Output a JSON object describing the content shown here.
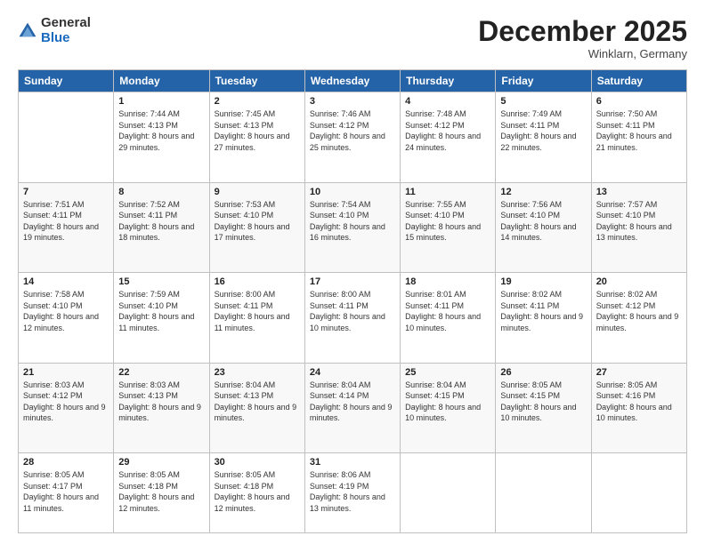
{
  "header": {
    "logo": {
      "general": "General",
      "blue": "Blue"
    },
    "title": "December 2025",
    "location": "Winklarn, Germany"
  },
  "columns": [
    "Sunday",
    "Monday",
    "Tuesday",
    "Wednesday",
    "Thursday",
    "Friday",
    "Saturday"
  ],
  "weeks": [
    [
      {
        "day": "",
        "sunrise": "",
        "sunset": "",
        "daylight": ""
      },
      {
        "day": "1",
        "sunrise": "Sunrise: 7:44 AM",
        "sunset": "Sunset: 4:13 PM",
        "daylight": "Daylight: 8 hours and 29 minutes."
      },
      {
        "day": "2",
        "sunrise": "Sunrise: 7:45 AM",
        "sunset": "Sunset: 4:13 PM",
        "daylight": "Daylight: 8 hours and 27 minutes."
      },
      {
        "day": "3",
        "sunrise": "Sunrise: 7:46 AM",
        "sunset": "Sunset: 4:12 PM",
        "daylight": "Daylight: 8 hours and 25 minutes."
      },
      {
        "day": "4",
        "sunrise": "Sunrise: 7:48 AM",
        "sunset": "Sunset: 4:12 PM",
        "daylight": "Daylight: 8 hours and 24 minutes."
      },
      {
        "day": "5",
        "sunrise": "Sunrise: 7:49 AM",
        "sunset": "Sunset: 4:11 PM",
        "daylight": "Daylight: 8 hours and 22 minutes."
      },
      {
        "day": "6",
        "sunrise": "Sunrise: 7:50 AM",
        "sunset": "Sunset: 4:11 PM",
        "daylight": "Daylight: 8 hours and 21 minutes."
      }
    ],
    [
      {
        "day": "7",
        "sunrise": "Sunrise: 7:51 AM",
        "sunset": "Sunset: 4:11 PM",
        "daylight": "Daylight: 8 hours and 19 minutes."
      },
      {
        "day": "8",
        "sunrise": "Sunrise: 7:52 AM",
        "sunset": "Sunset: 4:11 PM",
        "daylight": "Daylight: 8 hours and 18 minutes."
      },
      {
        "day": "9",
        "sunrise": "Sunrise: 7:53 AM",
        "sunset": "Sunset: 4:10 PM",
        "daylight": "Daylight: 8 hours and 17 minutes."
      },
      {
        "day": "10",
        "sunrise": "Sunrise: 7:54 AM",
        "sunset": "Sunset: 4:10 PM",
        "daylight": "Daylight: 8 hours and 16 minutes."
      },
      {
        "day": "11",
        "sunrise": "Sunrise: 7:55 AM",
        "sunset": "Sunset: 4:10 PM",
        "daylight": "Daylight: 8 hours and 15 minutes."
      },
      {
        "day": "12",
        "sunrise": "Sunrise: 7:56 AM",
        "sunset": "Sunset: 4:10 PM",
        "daylight": "Daylight: 8 hours and 14 minutes."
      },
      {
        "day": "13",
        "sunrise": "Sunrise: 7:57 AM",
        "sunset": "Sunset: 4:10 PM",
        "daylight": "Daylight: 8 hours and 13 minutes."
      }
    ],
    [
      {
        "day": "14",
        "sunrise": "Sunrise: 7:58 AM",
        "sunset": "Sunset: 4:10 PM",
        "daylight": "Daylight: 8 hours and 12 minutes."
      },
      {
        "day": "15",
        "sunrise": "Sunrise: 7:59 AM",
        "sunset": "Sunset: 4:10 PM",
        "daylight": "Daylight: 8 hours and 11 minutes."
      },
      {
        "day": "16",
        "sunrise": "Sunrise: 8:00 AM",
        "sunset": "Sunset: 4:11 PM",
        "daylight": "Daylight: 8 hours and 11 minutes."
      },
      {
        "day": "17",
        "sunrise": "Sunrise: 8:00 AM",
        "sunset": "Sunset: 4:11 PM",
        "daylight": "Daylight: 8 hours and 10 minutes."
      },
      {
        "day": "18",
        "sunrise": "Sunrise: 8:01 AM",
        "sunset": "Sunset: 4:11 PM",
        "daylight": "Daylight: 8 hours and 10 minutes."
      },
      {
        "day": "19",
        "sunrise": "Sunrise: 8:02 AM",
        "sunset": "Sunset: 4:11 PM",
        "daylight": "Daylight: 8 hours and 9 minutes."
      },
      {
        "day": "20",
        "sunrise": "Sunrise: 8:02 AM",
        "sunset": "Sunset: 4:12 PM",
        "daylight": "Daylight: 8 hours and 9 minutes."
      }
    ],
    [
      {
        "day": "21",
        "sunrise": "Sunrise: 8:03 AM",
        "sunset": "Sunset: 4:12 PM",
        "daylight": "Daylight: 8 hours and 9 minutes."
      },
      {
        "day": "22",
        "sunrise": "Sunrise: 8:03 AM",
        "sunset": "Sunset: 4:13 PM",
        "daylight": "Daylight: 8 hours and 9 minutes."
      },
      {
        "day": "23",
        "sunrise": "Sunrise: 8:04 AM",
        "sunset": "Sunset: 4:13 PM",
        "daylight": "Daylight: 8 hours and 9 minutes."
      },
      {
        "day": "24",
        "sunrise": "Sunrise: 8:04 AM",
        "sunset": "Sunset: 4:14 PM",
        "daylight": "Daylight: 8 hours and 9 minutes."
      },
      {
        "day": "25",
        "sunrise": "Sunrise: 8:04 AM",
        "sunset": "Sunset: 4:15 PM",
        "daylight": "Daylight: 8 hours and 10 minutes."
      },
      {
        "day": "26",
        "sunrise": "Sunrise: 8:05 AM",
        "sunset": "Sunset: 4:15 PM",
        "daylight": "Daylight: 8 hours and 10 minutes."
      },
      {
        "day": "27",
        "sunrise": "Sunrise: 8:05 AM",
        "sunset": "Sunset: 4:16 PM",
        "daylight": "Daylight: 8 hours and 10 minutes."
      }
    ],
    [
      {
        "day": "28",
        "sunrise": "Sunrise: 8:05 AM",
        "sunset": "Sunset: 4:17 PM",
        "daylight": "Daylight: 8 hours and 11 minutes."
      },
      {
        "day": "29",
        "sunrise": "Sunrise: 8:05 AM",
        "sunset": "Sunset: 4:18 PM",
        "daylight": "Daylight: 8 hours and 12 minutes."
      },
      {
        "day": "30",
        "sunrise": "Sunrise: 8:05 AM",
        "sunset": "Sunset: 4:18 PM",
        "daylight": "Daylight: 8 hours and 12 minutes."
      },
      {
        "day": "31",
        "sunrise": "Sunrise: 8:06 AM",
        "sunset": "Sunset: 4:19 PM",
        "daylight": "Daylight: 8 hours and 13 minutes."
      },
      {
        "day": "",
        "sunrise": "",
        "sunset": "",
        "daylight": ""
      },
      {
        "day": "",
        "sunrise": "",
        "sunset": "",
        "daylight": ""
      },
      {
        "day": "",
        "sunrise": "",
        "sunset": "",
        "daylight": ""
      }
    ]
  ]
}
